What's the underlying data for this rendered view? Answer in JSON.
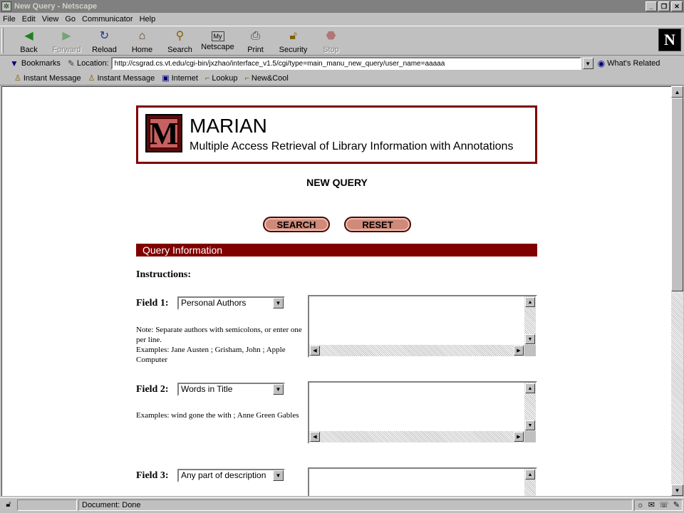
{
  "window": {
    "title": "New Query - Netscape"
  },
  "menu": [
    "File",
    "Edit",
    "View",
    "Go",
    "Communicator",
    "Help"
  ],
  "toolbar": {
    "back": "Back",
    "forward": "Forward",
    "reload": "Reload",
    "home": "Home",
    "search": "Search",
    "netscape": "Netscape",
    "print": "Print",
    "security": "Security",
    "stop": "Stop"
  },
  "location": {
    "bookmarks": "Bookmarks",
    "label": "Location:",
    "url": "http://csgrad.cs.vt.edu/cgi-bin/jxzhao/interface_v1.5/cgi/type=main_manu_new_query/user_name=aaaaa",
    "related": "What's Related"
  },
  "personal": [
    "Instant Message",
    "Instant Message",
    "Internet",
    "Lookup",
    "New&Cool"
  ],
  "page": {
    "banner_title": "MARIAN",
    "banner_subtitle": "Multiple Access Retrieval of Library Information with Annotations",
    "logo_letter": "M",
    "heading": "NEW QUERY",
    "search_button": "SEARCH",
    "reset_button": "RESET",
    "section_title": "Query Information",
    "instructions": "Instructions:",
    "fields": [
      {
        "label": "Field 1:",
        "selected": "Personal Authors",
        "note": "Note: Separate authors with semicolons, or enter one per line.\nExamples: Jane Austen ; Grisham, John ; Apple Computer"
      },
      {
        "label": "Field 2:",
        "selected": "Words in Title",
        "note": "Examples: wind gone the with ; Anne Green Gables"
      },
      {
        "label": "Field 3:",
        "selected": "Any part of description",
        "note": ""
      }
    ]
  },
  "status": {
    "text": "Document: Done"
  }
}
